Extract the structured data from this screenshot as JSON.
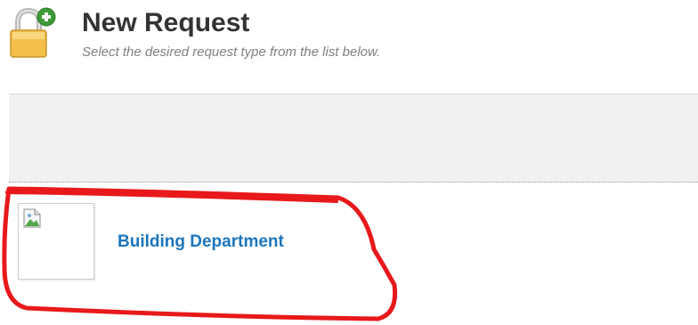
{
  "header": {
    "icon": "lock-add-icon",
    "title": "New Request",
    "subtitle": "Select the desired request type from the list below."
  },
  "request_types": [
    {
      "label": "Building Department",
      "thumbnail_icon": "broken-image-icon"
    }
  ],
  "colors": {
    "title": "#333333",
    "subtitle": "#808080",
    "link": "#1b75bb",
    "band": "#f1f1f1",
    "annotation": "#e8191b",
    "lock_body": "#f2c04a",
    "plus_badge": "#3d9b35"
  }
}
